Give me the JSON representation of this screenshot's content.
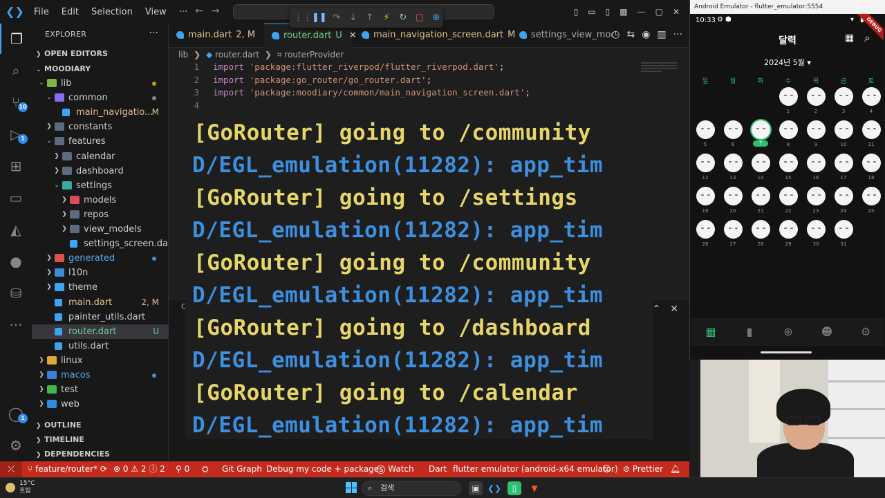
{
  "titlebar": {
    "menu": [
      "File",
      "Edit",
      "Selection",
      "View",
      "···"
    ]
  },
  "activity": {
    "source_control_badge": "10",
    "run_badge": "1",
    "accounts_badge": "1"
  },
  "explorer": {
    "title": "EXPLORER",
    "open_editors": "OPEN EDITORS",
    "project": "MOODIARY",
    "outline": "OUTLINE",
    "timeline": "TIMELINE",
    "dependencies": "DEPENDENCIES",
    "rows": [
      {
        "label": "lib",
        "status": ""
      },
      {
        "label": "common",
        "status": ""
      },
      {
        "label": "main_navigatio...",
        "status": "M"
      },
      {
        "label": "constants",
        "status": ""
      },
      {
        "label": "features",
        "status": ""
      },
      {
        "label": "calendar",
        "status": ""
      },
      {
        "label": "dashboard",
        "status": ""
      },
      {
        "label": "settings",
        "status": ""
      },
      {
        "label": "models",
        "status": ""
      },
      {
        "label": "repos",
        "status": ""
      },
      {
        "label": "view_models",
        "status": ""
      },
      {
        "label": "settings_screen.dart",
        "status": ""
      },
      {
        "label": "generated",
        "status": ""
      },
      {
        "label": "l10n",
        "status": ""
      },
      {
        "label": "theme",
        "status": ""
      },
      {
        "label": "main.dart",
        "status": "2, M"
      },
      {
        "label": "painter_utils.dart",
        "status": ""
      },
      {
        "label": "router.dart",
        "status": "U"
      },
      {
        "label": "utils.dart",
        "status": ""
      },
      {
        "label": "linux",
        "status": ""
      },
      {
        "label": "macos",
        "status": ""
      },
      {
        "label": "test",
        "status": ""
      },
      {
        "label": "web",
        "status": ""
      }
    ]
  },
  "tabs": [
    {
      "label": "main.dart",
      "status": "2, M"
    },
    {
      "label": "router.dart",
      "status": "U"
    },
    {
      "label": "main_navigation_screen.dart",
      "status": "M"
    },
    {
      "label": "settings_view_model.",
      "status": ""
    }
  ],
  "breadcrumb": {
    "folder": "lib",
    "file": "router.dart",
    "symbol": "routerProvider"
  },
  "code": {
    "lines": [
      {
        "n": "1",
        "kw": "import",
        "str": "'package:flutter_riverpod/flutter_riverpod.dart'",
        "end": ";"
      },
      {
        "n": "2",
        "kw": "import",
        "str": "'package:go_router/go_router.dart'",
        "end": ";"
      },
      {
        "n": "3",
        "kw": "import",
        "str": "'package:moodiary/common/main_navigation_screen.dart'",
        "end": ";"
      },
      {
        "n": "4",
        "kw": "",
        "str": "",
        "end": ""
      }
    ]
  },
  "console": {
    "panel_label": "C",
    "lines": [
      {
        "kind": "go",
        "text": "[GoRouter] going to /community"
      },
      {
        "kind": "egl",
        "text": "D/EGL_emulation(11282): app_tim"
      },
      {
        "kind": "go",
        "text": "[GoRouter] going to /settings"
      },
      {
        "kind": "egl",
        "text": "D/EGL_emulation(11282): app_tim"
      },
      {
        "kind": "go",
        "text": "[GoRouter] going to /community"
      },
      {
        "kind": "egl",
        "text": "D/EGL_emulation(11282): app_tim"
      },
      {
        "kind": "go",
        "text": "[GoRouter] going to /dashboard"
      },
      {
        "kind": "egl",
        "text": "D/EGL_emulation(11282): app_tim"
      },
      {
        "kind": "go",
        "text": "[GoRouter] going to /calendar"
      },
      {
        "kind": "egl",
        "text": "D/EGL_emulation(11282): app_tim"
      }
    ]
  },
  "statusbar": {
    "branch": "feature/router*",
    "problems": "⊗ 0 ⚠ 2 ⓘ 2",
    "ports": "0",
    "git_graph": "Git Graph",
    "debug_mode": "Debug my code + packages",
    "watch": "Watch",
    "language": "Dart",
    "device": "flutter emulator (android-x64 emulator)",
    "prettier": "Prettier"
  },
  "taskbar": {
    "temperature": "15°C",
    "weather": "흐림",
    "search_placeholder": "검색"
  },
  "emulator": {
    "window_title": "Android Emulator - flutter_emulator:5554",
    "time": "10:33",
    "debug_banner": "DEBUG",
    "app_title": "달력",
    "month": "2024년 5월",
    "weekdays": [
      "일",
      "월",
      "화",
      "수",
      "목",
      "금",
      "토"
    ],
    "first_weekday_index": 3,
    "days_in_month": 31,
    "today": 7,
    "accent": "#2fbf71"
  },
  "colors": {
    "statusbar": "#c42b1c",
    "goRouter": "#e6d66a",
    "egl": "#3d8fe0",
    "accent": "#3ea4f0"
  }
}
